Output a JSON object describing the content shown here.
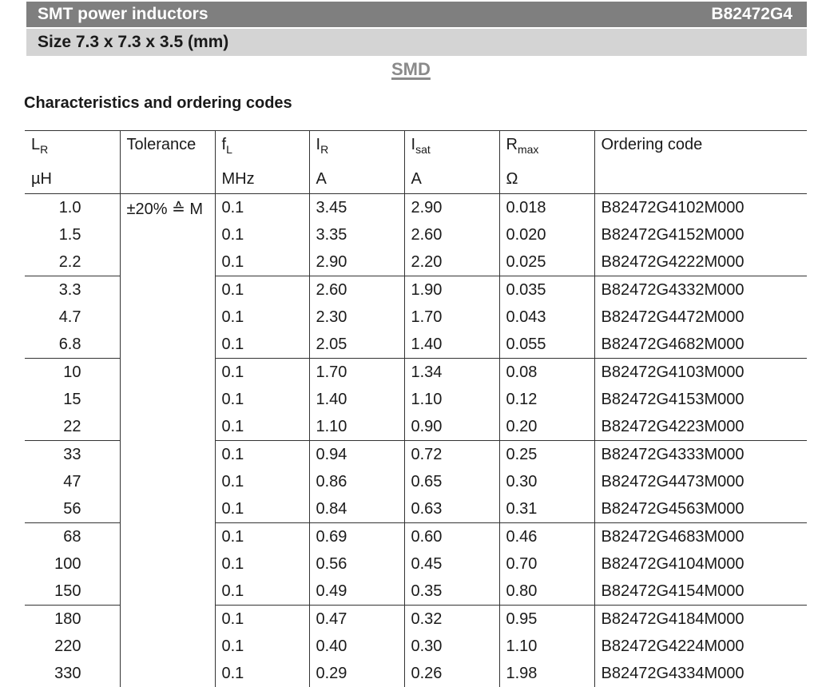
{
  "header": {
    "title": "SMT power inductors",
    "part": "B82472G4",
    "size": "Size 7.3 x 7.3 x 3.5 (mm)",
    "mount_label": "SMD"
  },
  "section_title": "Characteristics and ordering codes",
  "columns": {
    "lr": {
      "symbol": "L",
      "sub": "R",
      "unit": "µH"
    },
    "tolerance": {
      "label": "Tolerance"
    },
    "fl": {
      "symbol": "f",
      "sub": "L",
      "unit": "MHz"
    },
    "ir": {
      "symbol": "I",
      "sub": "R",
      "unit": "A"
    },
    "isat": {
      "symbol": "I",
      "sub": "sat",
      "unit": "A"
    },
    "rmax": {
      "symbol": "R",
      "sub": "max",
      "unit": "Ω"
    },
    "code": {
      "label": "Ordering code"
    }
  },
  "tolerance_value": "±20% ≙ M",
  "rows": [
    {
      "lr": "1.0",
      "fl": "0.1",
      "ir": "3.45",
      "isat": "2.90",
      "rmax": "0.018",
      "code": "B82472G4102M000"
    },
    {
      "lr": "1.5",
      "fl": "0.1",
      "ir": "3.35",
      "isat": "2.60",
      "rmax": "0.020",
      "code": "B82472G4152M000"
    },
    {
      "lr": "2.2",
      "fl": "0.1",
      "ir": "2.90",
      "isat": "2.20",
      "rmax": "0.025",
      "code": "B82472G4222M000"
    },
    {
      "lr": "3.3",
      "fl": "0.1",
      "ir": "2.60",
      "isat": "1.90",
      "rmax": "0.035",
      "code": "B82472G4332M000"
    },
    {
      "lr": "4.7",
      "fl": "0.1",
      "ir": "2.30",
      "isat": "1.70",
      "rmax": "0.043",
      "code": "B82472G4472M000"
    },
    {
      "lr": "6.8",
      "fl": "0.1",
      "ir": "2.05",
      "isat": "1.40",
      "rmax": "0.055",
      "code": "B82472G4682M000"
    },
    {
      "lr": "10",
      "fl": "0.1",
      "ir": "1.70",
      "isat": "1.34",
      "rmax": "0.08",
      "code": "B82472G4103M000"
    },
    {
      "lr": "15",
      "fl": "0.1",
      "ir": "1.40",
      "isat": "1.10",
      "rmax": "0.12",
      "code": "B82472G4153M000"
    },
    {
      "lr": "22",
      "fl": "0.1",
      "ir": "1.10",
      "isat": "0.90",
      "rmax": "0.20",
      "code": "B82472G4223M000"
    },
    {
      "lr": "33",
      "fl": "0.1",
      "ir": "0.94",
      "isat": "0.72",
      "rmax": "0.25",
      "code": "B82472G4333M000"
    },
    {
      "lr": "47",
      "fl": "0.1",
      "ir": "0.86",
      "isat": "0.65",
      "rmax": "0.30",
      "code": "B82472G4473M000"
    },
    {
      "lr": "56",
      "fl": "0.1",
      "ir": "0.84",
      "isat": "0.63",
      "rmax": "0.31",
      "code": "B82472G4563M000"
    },
    {
      "lr": "68",
      "fl": "0.1",
      "ir": "0.69",
      "isat": "0.60",
      "rmax": "0.46",
      "code": "B82472G4683M000"
    },
    {
      "lr": "100",
      "fl": "0.1",
      "ir": "0.56",
      "isat": "0.45",
      "rmax": "0.70",
      "code": "B82472G4104M000"
    },
    {
      "lr": "150",
      "fl": "0.1",
      "ir": "0.49",
      "isat": "0.35",
      "rmax": "0.80",
      "code": "B82472G4154M000"
    },
    {
      "lr": "180",
      "fl": "0.1",
      "ir": "0.47",
      "isat": "0.32",
      "rmax": "0.95",
      "code": "B82472G4184M000"
    },
    {
      "lr": "220",
      "fl": "0.1",
      "ir": "0.40",
      "isat": "0.30",
      "rmax": "1.10",
      "code": "B82472G4224M000"
    },
    {
      "lr": "330",
      "fl": "0.1",
      "ir": "0.29",
      "isat": "0.26",
      "rmax": "1.98",
      "code": "B82472G4334M000"
    }
  ]
}
